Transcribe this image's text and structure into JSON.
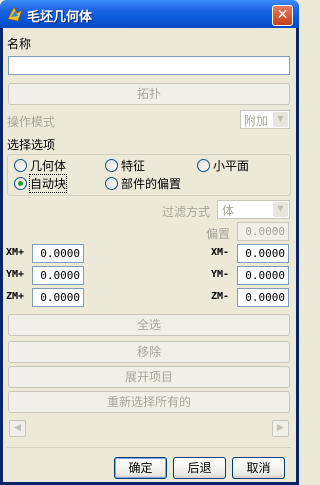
{
  "window": {
    "title": "毛坯几何体",
    "close_label": "✕"
  },
  "name_section": {
    "label": "名称",
    "value": ""
  },
  "topology_button": "拓扑",
  "operation_mode": {
    "label": "操作模式",
    "value": "附加"
  },
  "selection_options": {
    "label": "选择选项",
    "options": [
      "几何体",
      "特征",
      "小平面",
      "自动块",
      "部件的偏置"
    ],
    "selected": "自动块"
  },
  "filter": {
    "label": "过滤方式",
    "value": "体"
  },
  "offset": {
    "label": "偏置",
    "value": "0.0000"
  },
  "coords": {
    "xplus_label": "XM+",
    "xplus": "0.0000",
    "yplus_label": "YM+",
    "yplus": "0.0000",
    "zplus_label": "ZM+",
    "zplus": "0.0000",
    "xminus_label": "XM-",
    "xminus": "0.0000",
    "yminus_label": "YM-",
    "yminus": "0.0000",
    "zminus_label": "ZM-",
    "zminus": "0.0000"
  },
  "list_buttons": {
    "select_all": "全选",
    "remove": "移除",
    "expand": "展开项目",
    "reselect_all": "重新选择所有的"
  },
  "scroll": {
    "left_icon": "left-arrow-icon",
    "right_icon": "right-arrow-icon"
  },
  "footer": {
    "ok": "确定",
    "back": "后退",
    "cancel": "取消"
  },
  "colors": {
    "titlebar": "#0A56D8",
    "face": "#ECE9D8",
    "disabled_text": "#A7A69A",
    "radio_dot": "#21A121"
  }
}
